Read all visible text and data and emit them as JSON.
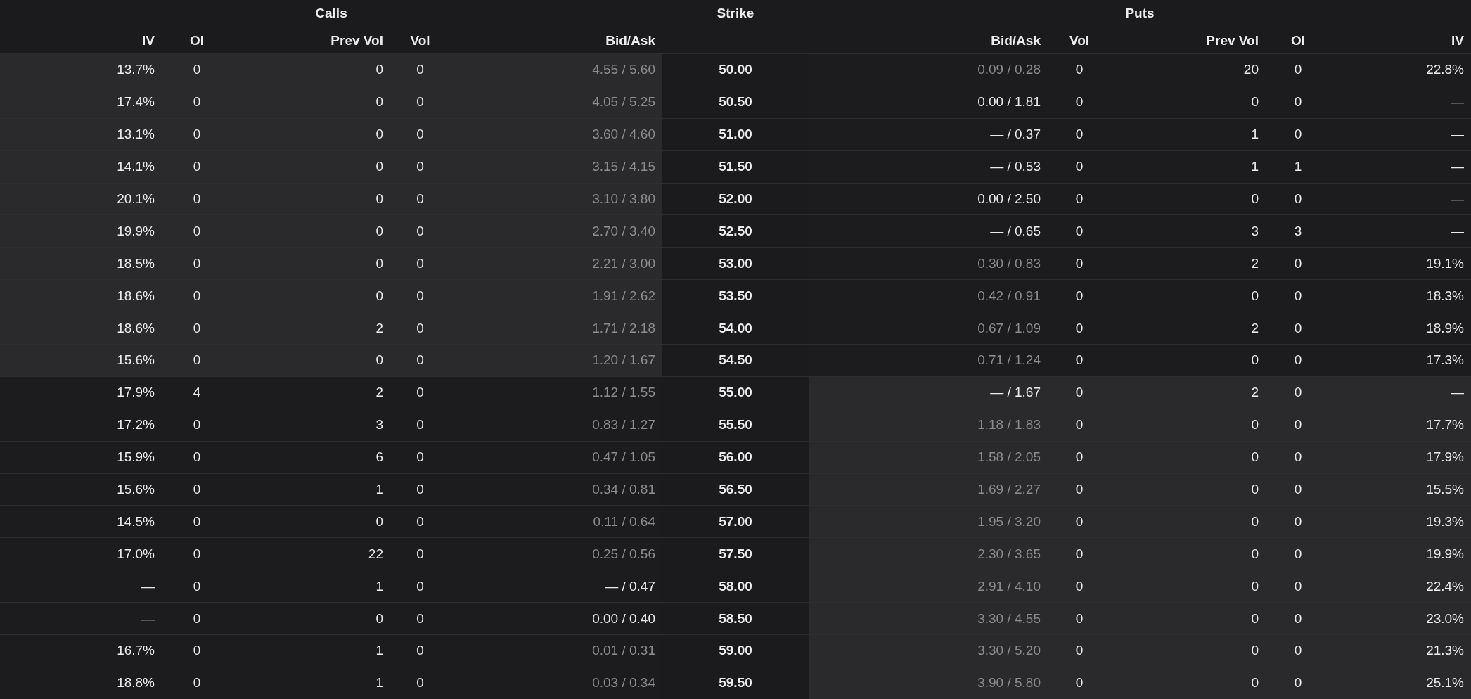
{
  "groups": {
    "calls": "Calls",
    "strike": "Strike",
    "puts": "Puts"
  },
  "columns": {
    "calls": [
      "IV",
      "OI",
      "Prev Vol",
      "Vol",
      "Bid/Ask"
    ],
    "puts": [
      "Bid/Ask",
      "Vol",
      "Prev Vol",
      "OI",
      "IV"
    ]
  },
  "rows": [
    {
      "strike": "50.00",
      "call": {
        "itm": true,
        "iv": "13.7%",
        "oi": "0",
        "prev_vol": "0",
        "vol": "0",
        "bid_ask": "4.55 / 5.60",
        "dimmed": true
      },
      "put": {
        "itm": false,
        "bid_ask": "0.09 / 0.28",
        "dimmed": true,
        "vol": "0",
        "prev_vol": "20",
        "oi": "0",
        "iv": "22.8%"
      }
    },
    {
      "strike": "50.50",
      "call": {
        "itm": true,
        "iv": "17.4%",
        "oi": "0",
        "prev_vol": "0",
        "vol": "0",
        "bid_ask": "4.05 / 5.25",
        "dimmed": true
      },
      "put": {
        "itm": false,
        "bid_ask": "0.00 / 1.81",
        "dimmed": false,
        "vol": "0",
        "prev_vol": "0",
        "oi": "0",
        "iv": "—"
      }
    },
    {
      "strike": "51.00",
      "call": {
        "itm": true,
        "iv": "13.1%",
        "oi": "0",
        "prev_vol": "0",
        "vol": "0",
        "bid_ask": "3.60 / 4.60",
        "dimmed": true
      },
      "put": {
        "itm": false,
        "bid_ask": "— / 0.37",
        "dimmed": false,
        "vol": "0",
        "prev_vol": "1",
        "oi": "0",
        "iv": "—"
      }
    },
    {
      "strike": "51.50",
      "call": {
        "itm": true,
        "iv": "14.1%",
        "oi": "0",
        "prev_vol": "0",
        "vol": "0",
        "bid_ask": "3.15 / 4.15",
        "dimmed": true
      },
      "put": {
        "itm": false,
        "bid_ask": "— / 0.53",
        "dimmed": false,
        "vol": "0",
        "prev_vol": "1",
        "oi": "1",
        "iv": "—"
      }
    },
    {
      "strike": "52.00",
      "call": {
        "itm": true,
        "iv": "20.1%",
        "oi": "0",
        "prev_vol": "0",
        "vol": "0",
        "bid_ask": "3.10 / 3.80",
        "dimmed": true
      },
      "put": {
        "itm": false,
        "bid_ask": "0.00 / 2.50",
        "dimmed": false,
        "vol": "0",
        "prev_vol": "0",
        "oi": "0",
        "iv": "—"
      }
    },
    {
      "strike": "52.50",
      "call": {
        "itm": true,
        "iv": "19.9%",
        "oi": "0",
        "prev_vol": "0",
        "vol": "0",
        "bid_ask": "2.70 / 3.40",
        "dimmed": true
      },
      "put": {
        "itm": false,
        "bid_ask": "— / 0.65",
        "dimmed": false,
        "vol": "0",
        "prev_vol": "3",
        "oi": "3",
        "iv": "—"
      }
    },
    {
      "strike": "53.00",
      "call": {
        "itm": true,
        "iv": "18.5%",
        "oi": "0",
        "prev_vol": "0",
        "vol": "0",
        "bid_ask": "2.21 / 3.00",
        "dimmed": true
      },
      "put": {
        "itm": false,
        "bid_ask": "0.30 / 0.83",
        "dimmed": true,
        "vol": "0",
        "prev_vol": "2",
        "oi": "0",
        "iv": "19.1%"
      }
    },
    {
      "strike": "53.50",
      "call": {
        "itm": true,
        "iv": "18.6%",
        "oi": "0",
        "prev_vol": "0",
        "vol": "0",
        "bid_ask": "1.91 / 2.62",
        "dimmed": true
      },
      "put": {
        "itm": false,
        "bid_ask": "0.42 / 0.91",
        "dimmed": true,
        "vol": "0",
        "prev_vol": "0",
        "oi": "0",
        "iv": "18.3%"
      }
    },
    {
      "strike": "54.00",
      "call": {
        "itm": true,
        "iv": "18.6%",
        "oi": "0",
        "prev_vol": "2",
        "vol": "0",
        "bid_ask": "1.71 / 2.18",
        "dimmed": true
      },
      "put": {
        "itm": false,
        "bid_ask": "0.67 / 1.09",
        "dimmed": true,
        "vol": "0",
        "prev_vol": "2",
        "oi": "0",
        "iv": "18.9%"
      }
    },
    {
      "strike": "54.50",
      "call": {
        "itm": true,
        "iv": "15.6%",
        "oi": "0",
        "prev_vol": "0",
        "vol": "0",
        "bid_ask": "1.20 / 1.67",
        "dimmed": true
      },
      "put": {
        "itm": false,
        "bid_ask": "0.71 / 1.24",
        "dimmed": true,
        "vol": "0",
        "prev_vol": "0",
        "oi": "0",
        "iv": "17.3%"
      }
    },
    {
      "strike": "55.00",
      "call": {
        "itm": false,
        "iv": "17.9%",
        "oi": "4",
        "prev_vol": "2",
        "vol": "0",
        "bid_ask": "1.12 / 1.55",
        "dimmed": true
      },
      "put": {
        "itm": true,
        "bid_ask": "— / 1.67",
        "dimmed": false,
        "vol": "0",
        "prev_vol": "2",
        "oi": "0",
        "iv": "—"
      }
    },
    {
      "strike": "55.50",
      "call": {
        "itm": false,
        "iv": "17.2%",
        "oi": "0",
        "prev_vol": "3",
        "vol": "0",
        "bid_ask": "0.83 / 1.27",
        "dimmed": true
      },
      "put": {
        "itm": true,
        "bid_ask": "1.18 / 1.83",
        "dimmed": true,
        "vol": "0",
        "prev_vol": "0",
        "oi": "0",
        "iv": "17.7%"
      }
    },
    {
      "strike": "56.00",
      "call": {
        "itm": false,
        "iv": "15.9%",
        "oi": "0",
        "prev_vol": "6",
        "vol": "0",
        "bid_ask": "0.47 / 1.05",
        "dimmed": true
      },
      "put": {
        "itm": true,
        "bid_ask": "1.58 / 2.05",
        "dimmed": true,
        "vol": "0",
        "prev_vol": "0",
        "oi": "0",
        "iv": "17.9%"
      }
    },
    {
      "strike": "56.50",
      "call": {
        "itm": false,
        "iv": "15.6%",
        "oi": "0",
        "prev_vol": "1",
        "vol": "0",
        "bid_ask": "0.34 / 0.81",
        "dimmed": true
      },
      "put": {
        "itm": true,
        "bid_ask": "1.69 / 2.27",
        "dimmed": true,
        "vol": "0",
        "prev_vol": "0",
        "oi": "0",
        "iv": "15.5%"
      }
    },
    {
      "strike": "57.00",
      "call": {
        "itm": false,
        "iv": "14.5%",
        "oi": "0",
        "prev_vol": "0",
        "vol": "0",
        "bid_ask": "0.11 / 0.64",
        "dimmed": true
      },
      "put": {
        "itm": true,
        "bid_ask": "1.95 / 3.20",
        "dimmed": true,
        "vol": "0",
        "prev_vol": "0",
        "oi": "0",
        "iv": "19.3%"
      }
    },
    {
      "strike": "57.50",
      "call": {
        "itm": false,
        "iv": "17.0%",
        "oi": "0",
        "prev_vol": "22",
        "vol": "0",
        "bid_ask": "0.25 / 0.56",
        "dimmed": true
      },
      "put": {
        "itm": true,
        "bid_ask": "2.30 / 3.65",
        "dimmed": true,
        "vol": "0",
        "prev_vol": "0",
        "oi": "0",
        "iv": "19.9%"
      }
    },
    {
      "strike": "58.00",
      "call": {
        "itm": false,
        "iv": "—",
        "oi": "0",
        "prev_vol": "1",
        "vol": "0",
        "bid_ask": "— / 0.47",
        "dimmed": false
      },
      "put": {
        "itm": true,
        "bid_ask": "2.91 / 4.10",
        "dimmed": true,
        "vol": "0",
        "prev_vol": "0",
        "oi": "0",
        "iv": "22.4%"
      }
    },
    {
      "strike": "58.50",
      "call": {
        "itm": false,
        "iv": "—",
        "oi": "0",
        "prev_vol": "0",
        "vol": "0",
        "bid_ask": "0.00 / 0.40",
        "dimmed": false
      },
      "put": {
        "itm": true,
        "bid_ask": "3.30 / 4.55",
        "dimmed": true,
        "vol": "0",
        "prev_vol": "0",
        "oi": "0",
        "iv": "23.0%"
      }
    },
    {
      "strike": "59.00",
      "call": {
        "itm": false,
        "iv": "16.7%",
        "oi": "0",
        "prev_vol": "1",
        "vol": "0",
        "bid_ask": "0.01 / 0.31",
        "dimmed": true
      },
      "put": {
        "itm": true,
        "bid_ask": "3.30 / 5.20",
        "dimmed": true,
        "vol": "0",
        "prev_vol": "0",
        "oi": "0",
        "iv": "21.3%"
      }
    },
    {
      "strike": "59.50",
      "call": {
        "itm": false,
        "iv": "18.8%",
        "oi": "0",
        "prev_vol": "1",
        "vol": "0",
        "bid_ask": "0.03 / 0.34",
        "dimmed": true
      },
      "put": {
        "itm": true,
        "bid_ask": "3.90 / 5.80",
        "dimmed": true,
        "vol": "0",
        "prev_vol": "0",
        "oi": "0",
        "iv": "25.1%"
      }
    }
  ]
}
